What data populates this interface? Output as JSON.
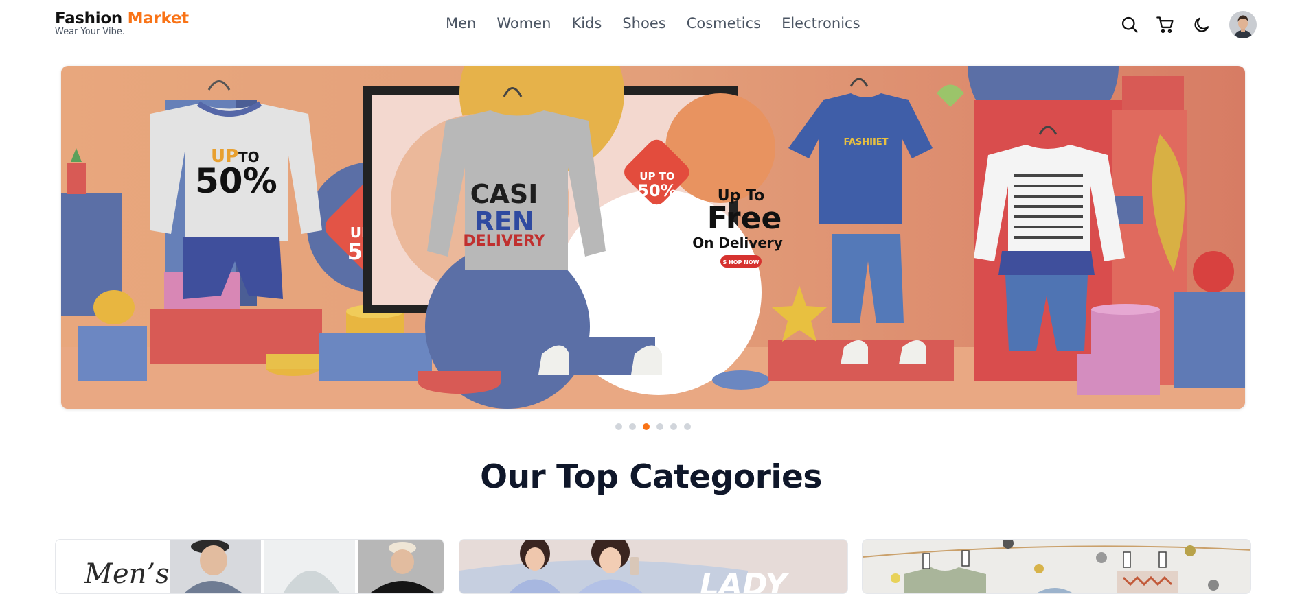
{
  "brand": {
    "name_part1": "Fashion",
    "name_part2": "Market",
    "tagline": "Wear Your Vibe."
  },
  "nav": {
    "items": [
      "Men",
      "Women",
      "Kids",
      "Shoes",
      "Cosmetics",
      "Electronics"
    ]
  },
  "header_icons": [
    "search-icon",
    "cart-icon",
    "moon-icon",
    "avatar"
  ],
  "banner": {
    "texts": {
      "left_up": "UP",
      "left_to": "TO",
      "left_pct": "50%",
      "tag1_up": "UP TO",
      "tag1_pct": "50%",
      "shirt_line1": "CASI",
      "shirt_line2": "REN",
      "shirt_line3": "DELIVERY",
      "tag2_up": "UP TO",
      "tag2_pct": "50%",
      "free_up": "Up To",
      "free_main": "Free",
      "free_on": "On Delivery",
      "free_btn": "S HOP NOW",
      "tshirt": "FASHIIET"
    }
  },
  "carousel": {
    "count": 6,
    "active_index": 2
  },
  "section": {
    "title": "Our Top Categories"
  },
  "categories": [
    {
      "label": "Men’s"
    },
    {
      "label": "LADY"
    },
    {
      "label": ""
    }
  ],
  "colors": {
    "accent": "#f97316",
    "text": "#111827",
    "muted": "#4b5563"
  }
}
